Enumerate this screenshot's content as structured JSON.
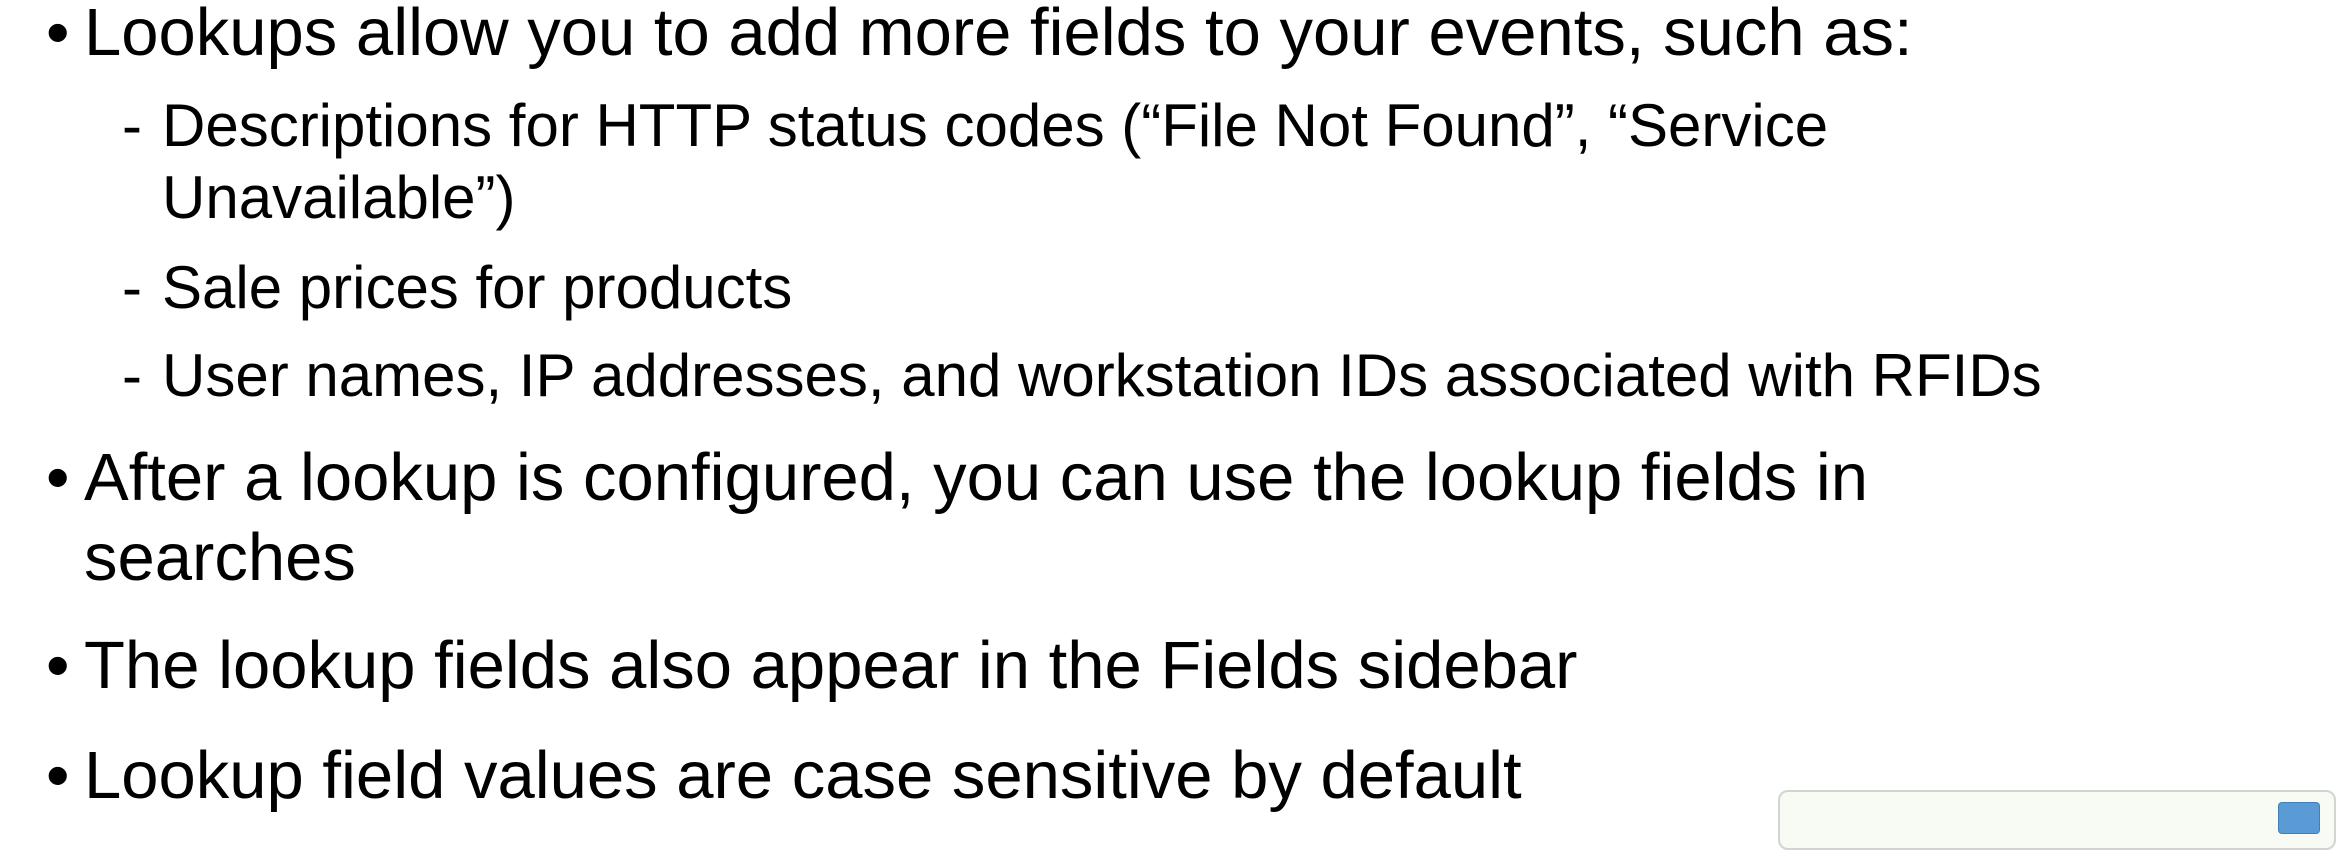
{
  "bullets": [
    {
      "marker": "•",
      "text": "Lookups allow you to add more fields to your events, such as:"
    },
    {
      "marker": "•",
      "text": "After a lookup is configured, you can use the lookup fields in searches"
    },
    {
      "marker": "•",
      "text": "The lookup fields also appear in the Fields sidebar"
    },
    {
      "marker": "•",
      "text": "Lookup field values are case sensitive by default"
    }
  ],
  "sub_bullets": [
    {
      "marker": "-",
      "text": "Descriptions for HTTP status codes (“File Not Found”, “Service Unavailable”)"
    },
    {
      "marker": "-",
      "text": "Sale prices for products"
    },
    {
      "marker": "-",
      "text": "User names, IP addresses, and workstation IDs associated with RFIDs"
    }
  ]
}
